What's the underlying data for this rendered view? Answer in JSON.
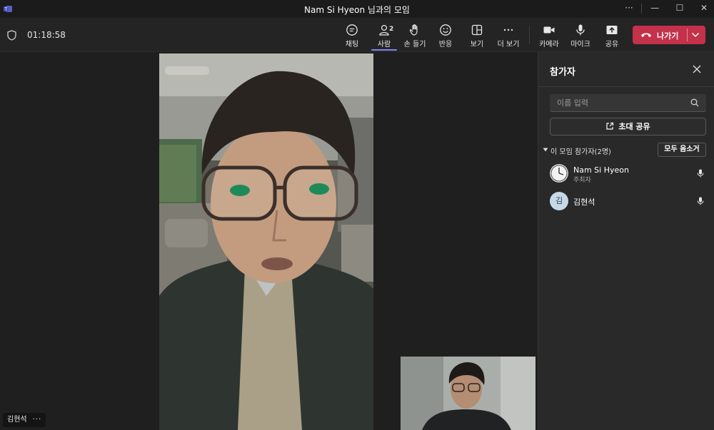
{
  "window": {
    "title": "Nam Si Hyeon 님과의 모임",
    "controls": {
      "more": "···",
      "minimize": "—",
      "maximize": "☐",
      "close": "✕"
    }
  },
  "toolbar": {
    "timer": "01:18:58",
    "buttons": [
      {
        "label": "채팅",
        "icon": "chat-icon"
      },
      {
        "label": "사람",
        "icon": "people-icon",
        "count": "2",
        "active": true
      },
      {
        "label": "손 들기",
        "icon": "raise-hand-icon"
      },
      {
        "label": "반응",
        "icon": "react-icon"
      },
      {
        "label": "보기",
        "icon": "view-icon"
      },
      {
        "label": "더 보기",
        "icon": "more-icon"
      },
      {
        "label": "카메라",
        "icon": "camera-icon"
      },
      {
        "label": "마이크",
        "icon": "mic-icon"
      },
      {
        "label": "공유",
        "icon": "share-icon"
      }
    ],
    "leave_label": "나가기",
    "colors": {
      "leave": "#c4314b",
      "active_indicator": "#7f85f5"
    }
  },
  "stage": {
    "main_speaker_name": "김현석",
    "name_chip_more": "···"
  },
  "panel": {
    "title": "참가자",
    "search_placeholder": "이름 입력",
    "invite_label": "초대 공유",
    "section_label": "이 모임 참가자(2명)",
    "mute_all_label": "모두 음소거",
    "participants": [
      {
        "name": "Nam Si Hyeon",
        "role": "주최자",
        "avatar": "clock-avatar"
      },
      {
        "name": "김현석",
        "initial": "김",
        "avatar": "initial-avatar"
      }
    ]
  }
}
